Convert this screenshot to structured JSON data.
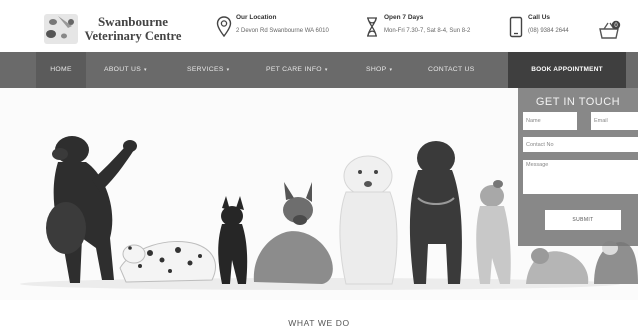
{
  "brand": {
    "name_line1": "Swanbourne",
    "name_line2": "Veterinary Centre"
  },
  "header": {
    "location": {
      "title": "Our Location",
      "detail": "2 Devon Rd Swanbourne WA 6010",
      "icon": "map-pin-icon"
    },
    "hours": {
      "title": "Open 7 Days",
      "detail": "Mon-Fri 7.30-7, Sat 8-4, Sun 8-2",
      "icon": "hourglass-icon"
    },
    "call": {
      "title": "Call Us",
      "detail": "(08) 9384 2644",
      "icon": "phone-icon"
    },
    "cart": {
      "count": "0",
      "icon": "basket-icon"
    }
  },
  "nav": {
    "home": "HOME",
    "about": "ABOUT US",
    "services": "SERVICES",
    "petcare": "PET CARE INFO",
    "shop": "SHOP",
    "contact": "CONTACT US",
    "caret": "▾",
    "book": "BOOK APPOINTMENT"
  },
  "contact_form": {
    "title": "GET IN TOUCH",
    "name_placeholder": "Name",
    "email_placeholder": "Email",
    "contact_placeholder": "Contact No",
    "message_placeholder": "Message",
    "submit": "SUBMIT"
  },
  "section": {
    "heading": "WHAT WE DO"
  },
  "colors": {
    "nav_bg": "#6a6a6a",
    "book_bg": "#3f3f3f",
    "panel_bg": "#787878"
  }
}
